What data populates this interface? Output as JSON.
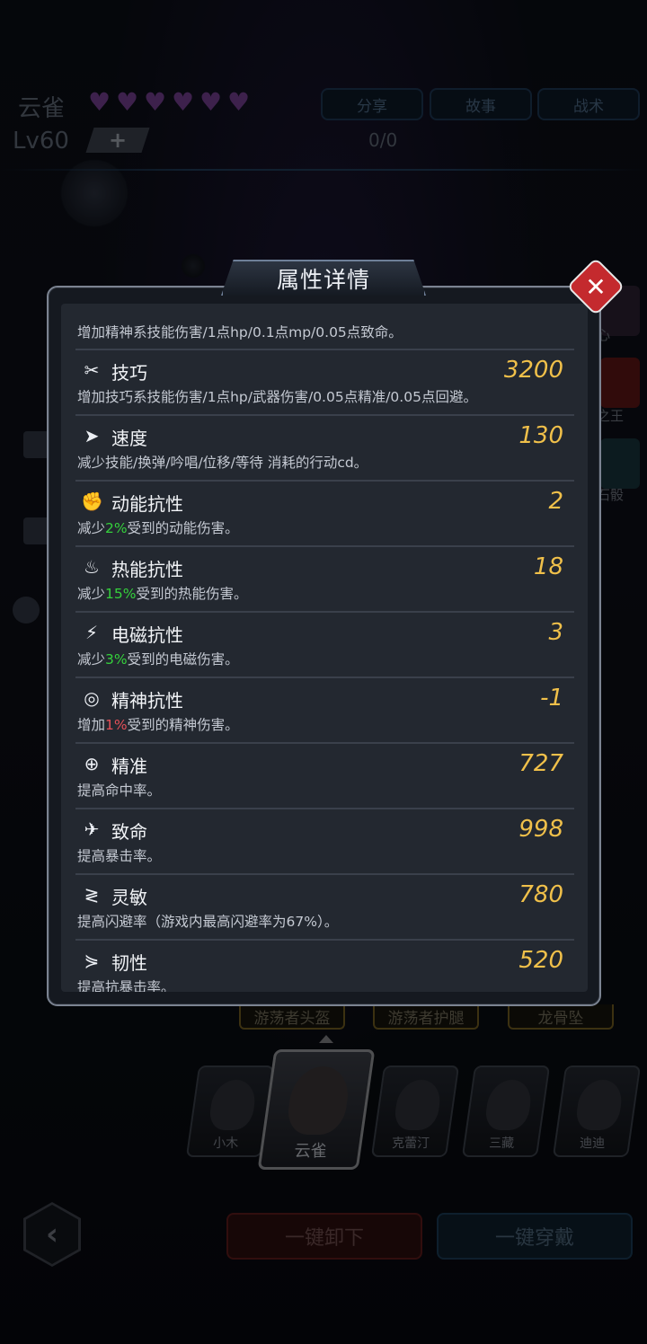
{
  "header": {
    "name": "云雀",
    "hearts": 6,
    "level": "Lv60",
    "plus": "+",
    "count": "0/0",
    "buttons": [
      "分享",
      "故事",
      "战术"
    ]
  },
  "side_labels_right": [
    "心",
    "之王",
    "石骰"
  ],
  "equipment_slots": [
    "游荡者头盔",
    "游荡者护腿",
    "龙骨坠"
  ],
  "heroes": [
    {
      "name": "小木"
    },
    {
      "name": "云雀",
      "selected": true
    },
    {
      "name": "克蕾汀"
    },
    {
      "name": "三藏"
    },
    {
      "name": "迪迪"
    }
  ],
  "bottom": {
    "back": "‹",
    "unequip_all": "一键卸下",
    "equip_all": "一键穿戴"
  },
  "modal": {
    "title": "属性详情",
    "close": "✕",
    "partial_row": {
      "desc": "增加精神系技能伤害/1点hp/0.1点mp/0.05点致命。"
    },
    "rows": [
      {
        "icon": "dexterity-icon",
        "glyph": "✂",
        "name": "技巧",
        "value": "3200",
        "desc": "增加技巧系技能伤害/1点hp/武器伤害/0.05点精准/0.05点回避。"
      },
      {
        "icon": "speed-icon",
        "glyph": "➤",
        "name": "速度",
        "value": "130",
        "desc": "减少技能/换弹/吟唱/位移/等待 消耗的行动cd。"
      },
      {
        "icon": "kinetic-resist-icon",
        "glyph": "✊",
        "name": "动能抗性",
        "value": "2",
        "desc_pre": "减少",
        "desc_pct": "2%",
        "desc_post": "受到的动能伤害。",
        "pct_color": "g"
      },
      {
        "icon": "thermal-resist-icon",
        "glyph": "♨",
        "name": "热能抗性",
        "value": "18",
        "desc_pre": "减少",
        "desc_pct": "15%",
        "desc_post": "受到的热能伤害。",
        "pct_color": "g"
      },
      {
        "icon": "em-resist-icon",
        "glyph": "⚡",
        "name": "电磁抗性",
        "value": "3",
        "desc_pre": "减少",
        "desc_pct": "3%",
        "desc_post": "受到的电磁伤害。",
        "pct_color": "g"
      },
      {
        "icon": "psychic-resist-icon",
        "glyph": "◎",
        "name": "精神抗性",
        "value": "-1",
        "desc_pre": "增加",
        "desc_pct": "1%",
        "desc_post": "受到的精神伤害。",
        "pct_color": "r"
      },
      {
        "icon": "precision-icon",
        "glyph": "⊕",
        "name": "精准",
        "value": "727",
        "desc": "提高命中率。"
      },
      {
        "icon": "critical-icon",
        "glyph": "✈",
        "name": "致命",
        "value": "998",
        "desc": "提高暴击率。"
      },
      {
        "icon": "agility-icon",
        "glyph": "≷",
        "name": "灵敏",
        "value": "780",
        "desc": "提高闪避率（游戏内最高闪避率为67%）。"
      },
      {
        "icon": "toughness-icon",
        "glyph": "⋟",
        "name": "韧性",
        "value": "520",
        "desc": "提高抗暴击率。"
      }
    ]
  },
  "colors": {
    "value": "#f0c04a",
    "positive_pct": "#35d13c",
    "negative_pct": "#e45058",
    "close_button": "#c42a2e"
  }
}
